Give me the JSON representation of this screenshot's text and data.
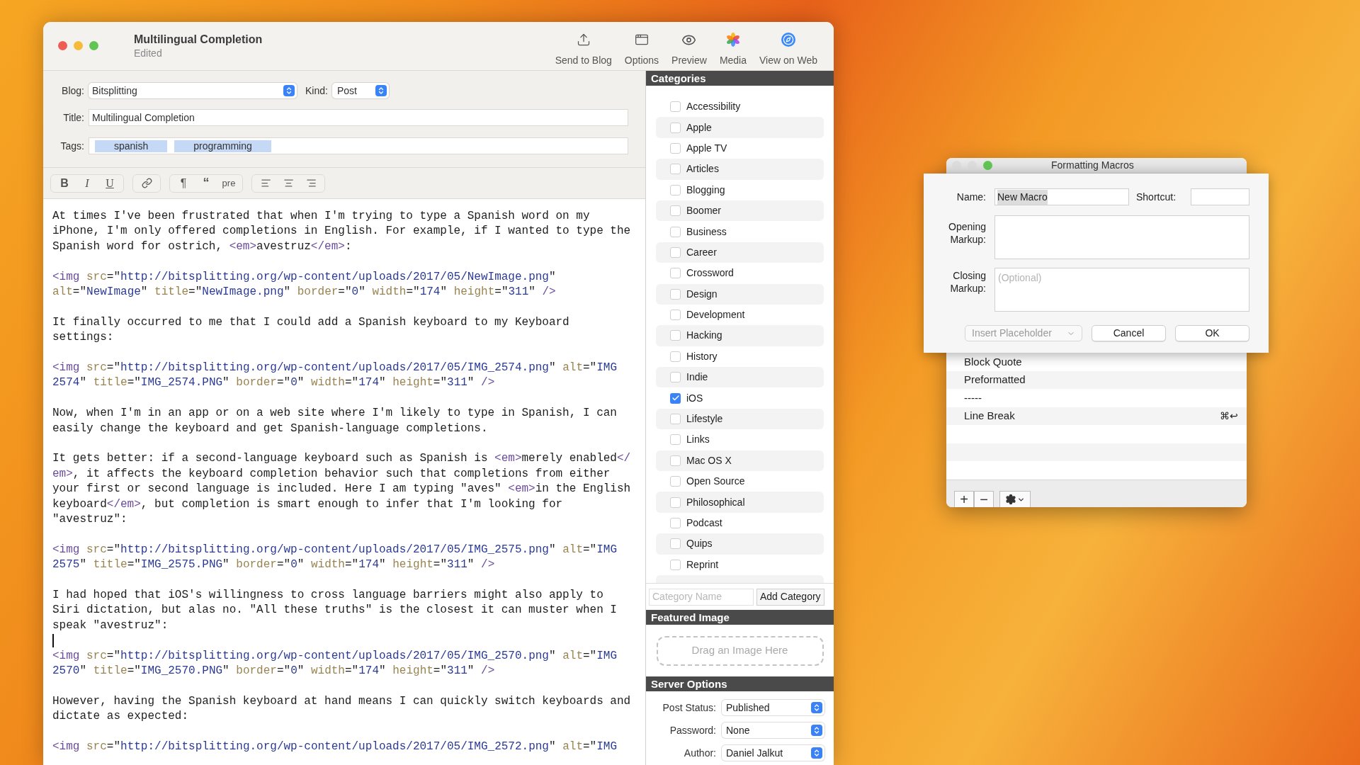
{
  "window": {
    "title": "Multilingual Completion",
    "subtitle": "Edited"
  },
  "toolbar": [
    {
      "kind": "upload",
      "label": "Send to Blog"
    },
    {
      "kind": "options",
      "label": "Options"
    },
    {
      "kind": "preview",
      "label": "Preview"
    },
    {
      "kind": "media",
      "label": "Media"
    },
    {
      "kind": "web",
      "label": "View on Web"
    }
  ],
  "post_fields": {
    "blog": {
      "label": "Blog:",
      "value": "Bitsplitting"
    },
    "kind": {
      "label": "Kind:",
      "value": "Post"
    },
    "title": {
      "label": "Title:",
      "value": "Multilingual Completion"
    },
    "tags": {
      "label": "Tags:",
      "items": [
        "spanish",
        "programming"
      ]
    }
  },
  "format_toolbar": [
    [
      {
        "kind": "bold",
        "label": "B"
      },
      {
        "kind": "italic",
        "label": "I"
      },
      {
        "kind": "underline",
        "label": "U"
      }
    ],
    [
      {
        "kind": "link"
      }
    ],
    [
      {
        "kind": "paragraph",
        "label": "¶"
      },
      {
        "kind": "quote",
        "label": "“"
      },
      {
        "kind": "pre",
        "label": "pre"
      }
    ],
    [
      {
        "kind": "align-left"
      },
      {
        "kind": "align-center"
      },
      {
        "kind": "align-right"
      }
    ]
  ],
  "editor": {
    "paragraphs": [
      {
        "kind": "prose",
        "lines": [
          "At times I've been frustrated that when I'm trying to type a Spanish word on my",
          "iPhone, I'm only offered completions in English. For example, if I wanted to type the",
          "Spanish word for ostrich, <em>avestruz</em>:"
        ]
      },
      {
        "kind": "code",
        "lines": [
          "<img src=\"http://bitsplitting.org/wp-content/uploads/2017/05/NewImage.png\"",
          "alt=\"NewImage\" title=\"NewImage.png\" border=\"0\" width=\"174\" height=\"311\" />"
        ]
      },
      {
        "kind": "prose",
        "lines": [
          "It finally occurred to me that I could add a Spanish keyboard to my Keyboard",
          "settings:"
        ]
      },
      {
        "kind": "code",
        "lines": [
          "<img src=\"http://bitsplitting.org/wp-content/uploads/2017/05/IMG_2574.png\" alt=\"IMG",
          "2574\" title=\"IMG_2574.PNG\" border=\"0\" width=\"174\" height=\"311\" />"
        ]
      },
      {
        "kind": "prose",
        "lines": [
          "Now, when I'm in an app or on a web site where I'm likely to type in Spanish, I can",
          "easily change the keyboard and get Spanish-language completions."
        ]
      },
      {
        "kind": "prose",
        "lines": [
          "It gets better: if a second-language keyboard such as Spanish is <em>merely enabled</",
          "em>, it affects the keyboard completion behavior such that completions from either",
          "your first or second language is included. Here I am typing \"aves\" <em>in the English",
          "keyboard</em>, but completion is smart enough to infer that I'm looking for",
          "\"avestruz\":"
        ]
      },
      {
        "kind": "code",
        "lines": [
          "<img src=\"http://bitsplitting.org/wp-content/uploads/2017/05/IMG_2575.png\" alt=\"IMG",
          "2575\" title=\"IMG_2575.PNG\" border=\"0\" width=\"174\" height=\"311\" />"
        ]
      },
      {
        "kind": "prose",
        "lines": [
          "I had hoped that iOS's willingness to cross language barriers might also apply to",
          "Siri dictation, but alas no. \"All these truths\" is the closest it can muster when I",
          "speak \"avestruz\":"
        ]
      },
      {
        "kind": "cursor"
      },
      {
        "kind": "code",
        "lines": [
          "<img src=\"http://bitsplitting.org/wp-content/uploads/2017/05/IMG_2570.png\" alt=\"IMG",
          "2570\" title=\"IMG_2570.PNG\" border=\"0\" width=\"174\" height=\"311\" />"
        ]
      },
      {
        "kind": "prose",
        "lines": [
          "However, having the Spanish keyboard at hand means I can quickly switch keyboards and",
          "dictate as expected:"
        ]
      },
      {
        "kind": "code",
        "lines": [
          "<img src=\"http://bitsplitting.org/wp-content/uploads/2017/05/IMG_2572.png\" alt=\"IMG"
        ]
      }
    ]
  },
  "categories": {
    "title": "Categories",
    "items": [
      {
        "label": "Accessibility",
        "checked": false
      },
      {
        "label": "Apple",
        "checked": false
      },
      {
        "label": "Apple TV",
        "checked": false
      },
      {
        "label": "Articles",
        "checked": false
      },
      {
        "label": "Blogging",
        "checked": false
      },
      {
        "label": "Boomer",
        "checked": false
      },
      {
        "label": "Business",
        "checked": false
      },
      {
        "label": "Career",
        "checked": false
      },
      {
        "label": "Crossword",
        "checked": false
      },
      {
        "label": "Design",
        "checked": false
      },
      {
        "label": "Development",
        "checked": false
      },
      {
        "label": "Hacking",
        "checked": false
      },
      {
        "label": "History",
        "checked": false
      },
      {
        "label": "Indie",
        "checked": false
      },
      {
        "label": "iOS",
        "checked": true
      },
      {
        "label": "Lifestyle",
        "checked": false
      },
      {
        "label": "Links",
        "checked": false
      },
      {
        "label": "Mac OS X",
        "checked": false
      },
      {
        "label": "Open Source",
        "checked": false
      },
      {
        "label": "Philosophical",
        "checked": false
      },
      {
        "label": "Podcast",
        "checked": false
      },
      {
        "label": "Quips",
        "checked": false
      },
      {
        "label": "Reprint",
        "checked": false
      }
    ],
    "new_category": {
      "placeholder": "Category Name",
      "button": "Add Category"
    }
  },
  "featured_image": {
    "title": "Featured Image",
    "drop_hint": "Drag an Image Here"
  },
  "server_options": {
    "title": "Server Options",
    "fields": [
      {
        "label": "Post Status:",
        "value": "Published"
      },
      {
        "label": "Password:",
        "value": "None"
      },
      {
        "label": "Author:",
        "value": "Daniel Jalkut"
      }
    ]
  },
  "macros_window": {
    "title": "Formatting Macros",
    "sheet": {
      "name_label": "Name:",
      "name_value": "New Macro",
      "shortcut_label": "Shortcut:",
      "opening_label": "Opening Markup:",
      "closing_label": "Closing Markup:",
      "closing_placeholder": "(Optional)",
      "placeholder_menu": {
        "label": "Insert Placeholder",
        "disabled": true
      },
      "buttons": [
        "Cancel",
        "OK"
      ]
    },
    "items": [
      {
        "label": "Block Quote"
      },
      {
        "label": "Preformatted"
      },
      {
        "label": "-----"
      },
      {
        "label": "Line Break",
        "shortcut": "⌘↩"
      }
    ],
    "buttons": [
      "+",
      "−"
    ]
  }
}
